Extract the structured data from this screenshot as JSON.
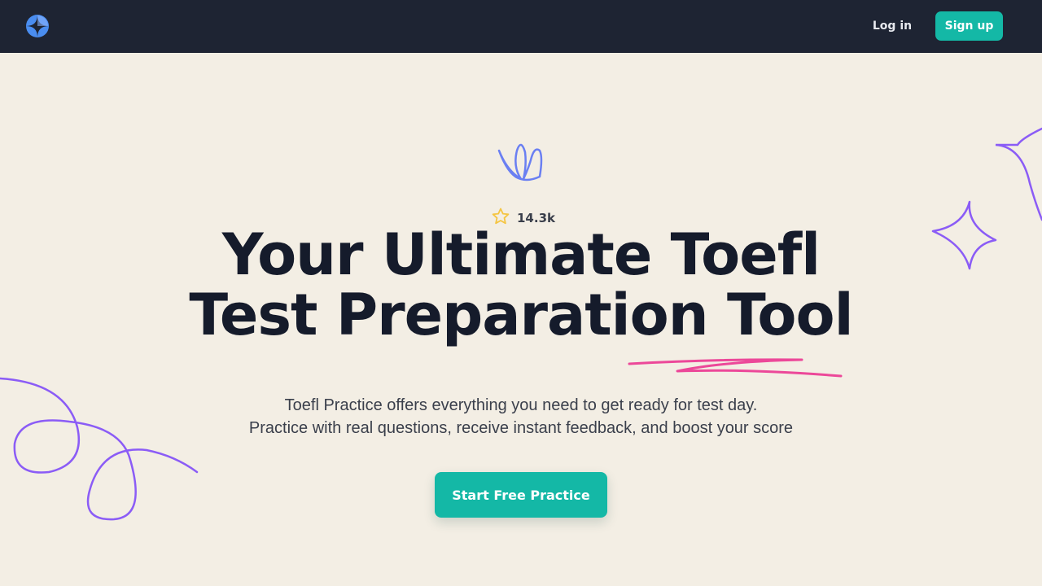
{
  "nav": {
    "logo_icon": "compass-logo-icon",
    "login_label": "Log in",
    "signup_label": "Sign up"
  },
  "hero": {
    "rating": {
      "icon": "star-icon",
      "count": "14.3k"
    },
    "title_line1": "Your Ultimate Toefl",
    "title_line2": "Test Preparation Tool",
    "subtitle_line1": "Toefl Practice offers everything you need to get ready for test day.",
    "subtitle_line2": "Practice with real questions, receive instant feedback, and boost your score",
    "cta_label": "Start Free Practice"
  },
  "colors": {
    "nav_bg": "#1e2433",
    "page_bg": "#f3eee4",
    "accent": "#14b8a6",
    "headline": "#151b2b",
    "doodle_purple": "#8b5cf6",
    "doodle_blue": "#6a7ff2",
    "underline_pink": "#ec4899",
    "star": "#f5c542"
  }
}
